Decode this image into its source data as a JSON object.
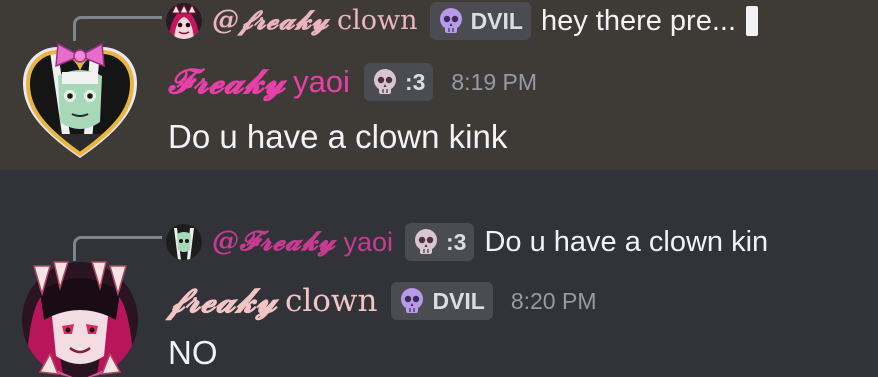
{
  "messages": [
    {
      "reply": {
        "author": "@𝓯𝓻𝓮𝓪𝓴𝔂",
        "author_suffix": "clown",
        "tag": "DVIL",
        "text": "hey there pre..."
      },
      "author": {
        "name": "𝓕𝓻𝓮𝓪𝓴𝔂",
        "suffix": "yaoi",
        "color": "#e93fa9"
      },
      "tag": ":3",
      "timestamp": "8:19 PM",
      "content": "Do u have a clown kink"
    },
    {
      "reply": {
        "author": "@𝓕𝓻𝓮𝓪𝓴𝔂",
        "author_suffix": "yaoi",
        "tag": ":3",
        "text": "Do u have a clown kin"
      },
      "author": {
        "name": "𝓯𝓻𝓮𝓪𝓴𝔂",
        "suffix": "clown",
        "color": "#f2c4c4"
      },
      "tag": "DVIL",
      "timestamp": "8:20 PM",
      "content": "NO"
    }
  ]
}
